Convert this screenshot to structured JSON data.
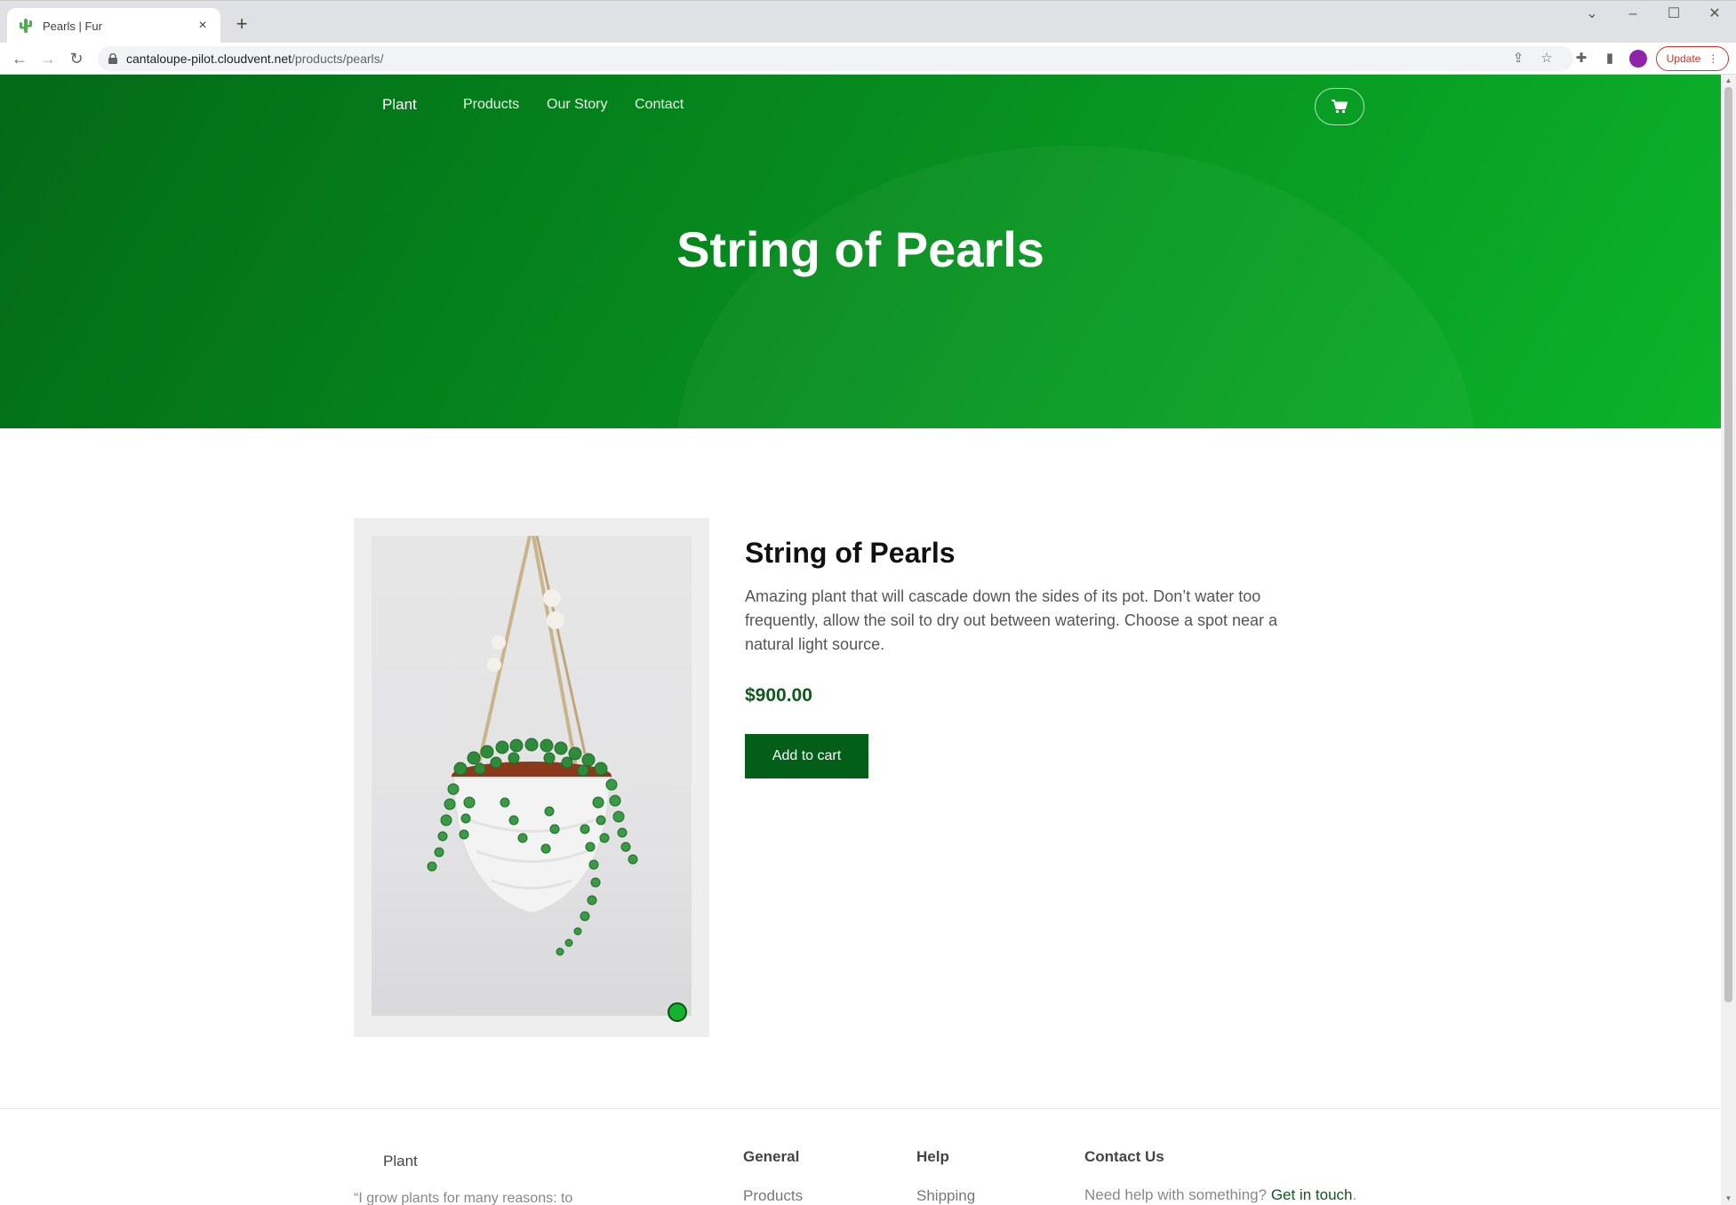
{
  "browser": {
    "tab_title": "Pearls | Fur",
    "url_host": "cantaloupe-pilot.cloudvent.net",
    "url_path": "/products/pearls/",
    "update_label": "Update"
  },
  "site": {
    "brand": "Plant",
    "nav": [
      "Products",
      "Our Story",
      "Contact"
    ]
  },
  "hero": {
    "title": "String of Pearls"
  },
  "product": {
    "name": "String of Pearls",
    "description": "Amazing plant that will cascade down the sides of its pot. Don’t water too frequently, allow the soil to dry out between watering. Choose a spot near a natural light source.",
    "price": "$900.00",
    "add_to_cart": "Add to cart"
  },
  "footer": {
    "brand": "Plant",
    "quote": "“I grow plants for many reasons: to",
    "general_heading": "General",
    "general_link": "Products",
    "help_heading": "Help",
    "help_link": "Shipping",
    "contact_heading": "Contact Us",
    "contact_text": "Need help with something?",
    "contact_link": "Get in touch",
    "contact_period": "."
  },
  "colors": {
    "hero_start": "#036a17",
    "hero_end": "#0bb42a",
    "button": "#035e17",
    "price": "#0d5a1a"
  }
}
